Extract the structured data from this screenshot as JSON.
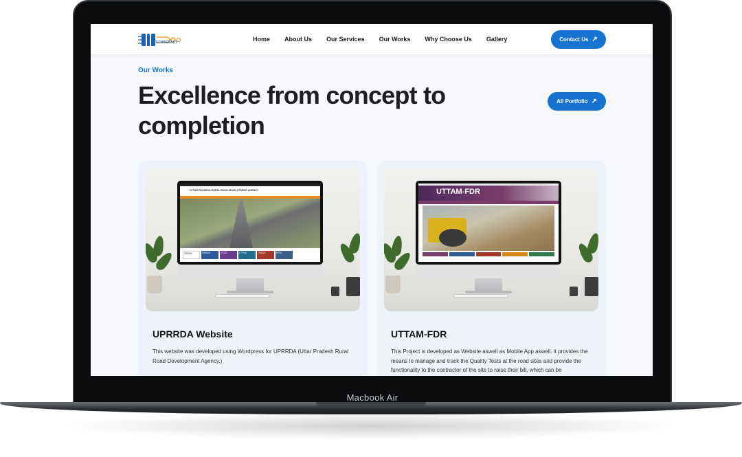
{
  "device": {
    "label": "Macbook Air"
  },
  "header": {
    "logo_text": "TECHSERACT",
    "nav": [
      "Home",
      "About Us",
      "Our Services",
      "Our Works",
      "Why Choose Us",
      "Gallery"
    ],
    "contact_label": "Contact Us"
  },
  "section": {
    "eyebrow": "Our Works",
    "headline": "Excellence from concept to completion",
    "portfolio_label": "All Portfolio"
  },
  "cards": [
    {
      "title": "UPRRDA Website",
      "desc": "This website was developed using Wordpress for UPRRDA (Uttar Pradesh Rural Road Development Agency.)",
      "screen_title": "UTTAR PRADESH RURAL ROAD DEVELOPMENT AGENCY",
      "stats": [
        "180556",
        "159940",
        "47222",
        "177941",
        "739421",
        "8754"
      ]
    },
    {
      "title": "UTTAM-FDR",
      "desc": "This Project is developed as Website aswell as Mobile App aswell. it provides the means to manage and track the Quality Tests at the road sites and provide the functionality to the contractor of the site to raise their bill, which can be",
      "screen_title": "UTTAM-FDR"
    }
  ],
  "colors": {
    "accent": "#1673cf",
    "heading": "#1d1e22",
    "card_bg": "#eef2fb"
  }
}
